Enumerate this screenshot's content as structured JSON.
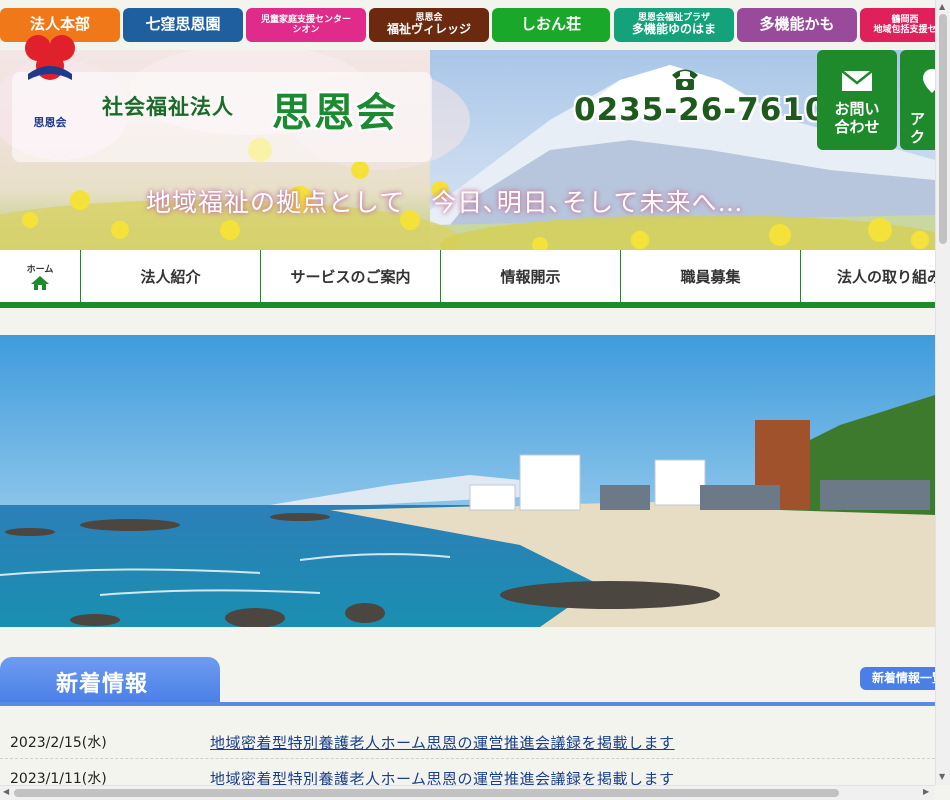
{
  "tabs": [
    {
      "id": "honbu",
      "lines": [
        "法人本部"
      ],
      "color": "#f07818",
      "size": "l1"
    },
    {
      "id": "shichikubo",
      "lines": [
        "七窪思恩園"
      ],
      "color": "#1f5f9f",
      "size": "l1"
    },
    {
      "id": "jido",
      "lines": [
        "児童家庭支援センター",
        "シオン"
      ],
      "color": "#e02b8a",
      "size": "s1"
    },
    {
      "id": "village",
      "lines": [
        "思恩会",
        "福祉ヴィレッジ"
      ],
      "color": "#6b2a10",
      "size": "s2"
    },
    {
      "id": "shion-so",
      "lines": [
        "しおん荘"
      ],
      "color": "#1aa82a",
      "size": "l1"
    },
    {
      "id": "yunohama",
      "lines": [
        "思恩会福祉プラザ",
        "多機能ゆのはま"
      ],
      "color": "#13a27a",
      "size": "s2"
    },
    {
      "id": "kamo",
      "lines": [
        "多機能かも"
      ],
      "color": "#9a4a9a",
      "size": "l1"
    },
    {
      "id": "tsuruoka",
      "lines": [
        "鶴岡西",
        "地域包括支援セ"
      ],
      "color": "#e0205a",
      "size": "s1"
    }
  ],
  "header": {
    "logo_sub": "思恩会",
    "org_type": "社会福祉法人",
    "org_name": "思恩会",
    "phone": "0235-26-7610",
    "tagline": "地域福祉の拠点として　今日､明日､そして未来へ…",
    "cta_contact": [
      "お問い",
      "合わせ"
    ],
    "cta_access": [
      "アク"
    ]
  },
  "nav": {
    "home_label": "ホーム",
    "items": [
      "法人紹介",
      "サービスのご案内",
      "情報開示",
      "職員募集",
      "法人の取り組み"
    ]
  },
  "news": {
    "title": "新着情報",
    "more": "新着情報一覧",
    "items": [
      {
        "date": "2023/2/15(水)",
        "title": "地域密着型特別養護老人ホーム思恩の運営推進会議録を掲載します"
      },
      {
        "date": "2023/1/11(水)",
        "title": "地域密着型特別養護老人ホーム思恩の運営推進会議録を掲載します"
      }
    ]
  },
  "colors": {
    "green": "#1f8a2c",
    "blue": "#4a7fe8",
    "nav_border": "#1f8a2c"
  }
}
